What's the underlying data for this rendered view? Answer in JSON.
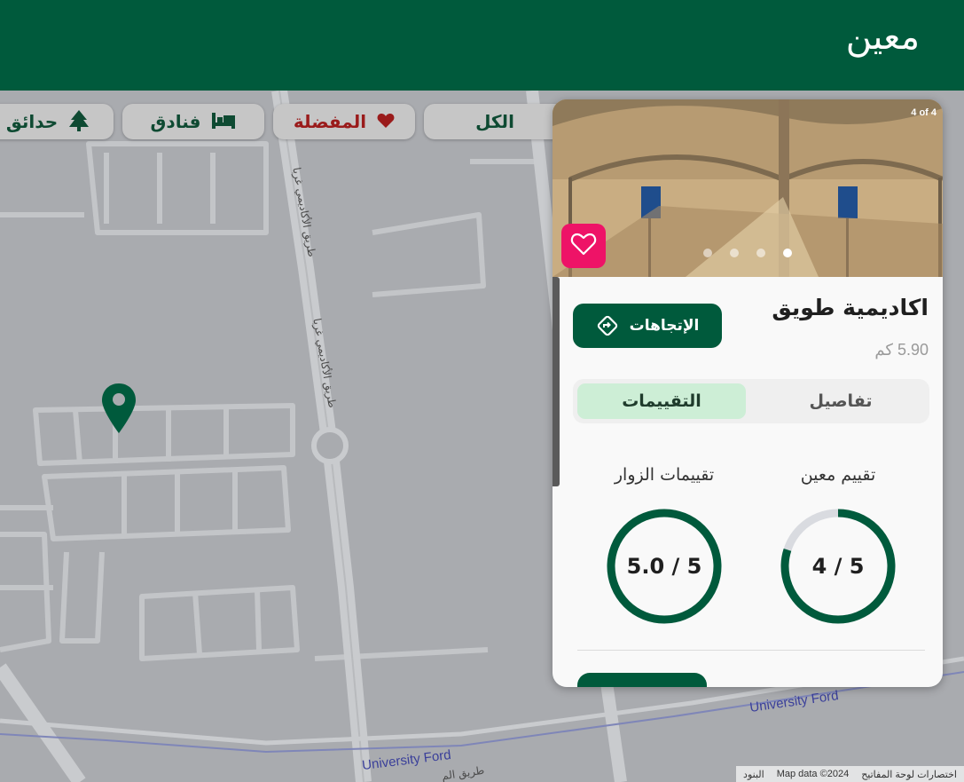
{
  "header": {
    "logo_text": "معين"
  },
  "filters": {
    "all": "الكل",
    "favorites": "المفضلة",
    "hotels": "فنادق",
    "parks": "حدائق"
  },
  "map": {
    "road_label_1": "University Ford",
    "road_label_2": "University Ford",
    "road_label_3": "طريق الأكاديمي غربا",
    "road_label_4": "طريق الأكاديمي غربا",
    "road_label_5": "طريق الم",
    "attribution": {
      "shortcuts": "اختصارات لوحة المفاتيح",
      "map_data": "Map data ©2024",
      "terms": "البنود"
    }
  },
  "card": {
    "photo_counter": "4 of 4",
    "photo_dots_count": 4,
    "photo_active_dot": 4,
    "title": "اكاديمية طويق",
    "distance": "5.90 كم",
    "directions_label": "الإتجاهات",
    "tabs": [
      {
        "label": "تفاصيل",
        "active": false
      },
      {
        "label": "التقييمات",
        "active": true
      }
    ],
    "ratings": {
      "moeen": {
        "label": "تقييم معين",
        "value_text": "4 / 5",
        "fraction": 0.8
      },
      "visitors": {
        "label": "تقييمات الزوار",
        "value_text": "5.0 / 5",
        "fraction": 1.0
      }
    }
  },
  "colors": {
    "brand_green": "#005a3c",
    "favorite_pink": "#ee1367",
    "favorite_red": "#9a1b1b",
    "active_tab": "#cdeed6",
    "ring_track": "#d9dbe0"
  },
  "icons": {
    "favorite_chip": "heart-icon",
    "hotel_chip": "bed-icon",
    "park_chip": "tree-icon",
    "directions": "directions-icon",
    "favorite_button": "heart-outline-icon",
    "map_pin": "map-pin-icon"
  }
}
